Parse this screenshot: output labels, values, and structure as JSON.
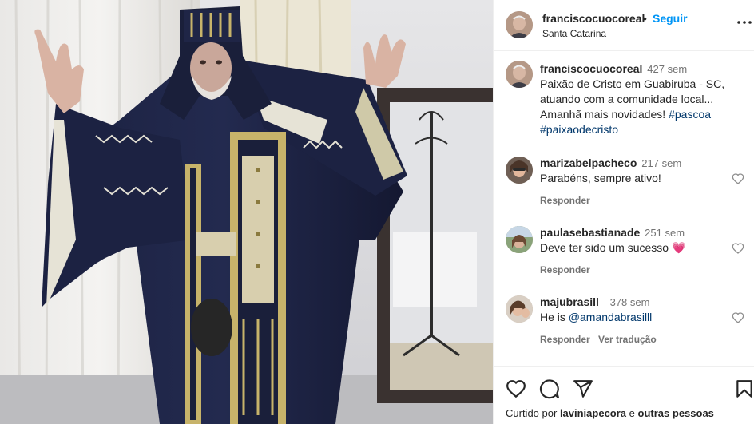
{
  "post": {
    "username": "franciscocuocoreal",
    "separator": "•",
    "follow_label": "Seguir",
    "location": "Santa Catarina"
  },
  "caption": {
    "username": "franciscocuocoreal",
    "time": "427 sem",
    "text": "Paixão de Cristo em Guabiruba - SC, atuando com a comunidade local... Amanhã mais novidades!",
    "hashtags": [
      "#pascoa",
      "#paixaodecristo"
    ]
  },
  "comments": [
    {
      "username": "marizabelpacheco",
      "time": "217 sem",
      "text": "Parabéns, sempre ativo!",
      "reply_label": "Responder"
    },
    {
      "username": "paulasebastianade",
      "time": "251 sem",
      "text": "Deve ter sido um sucesso",
      "emoji": "💗",
      "reply_label": "Responder"
    },
    {
      "username": "majubrasill_",
      "time": "378 sem",
      "text": "He is",
      "mention": "@amandabrasilll_",
      "reply_label": "Responder",
      "translate_label": "Ver tradução"
    }
  ],
  "likes": {
    "prefix": "Curtido por",
    "user": "laviniapecora",
    "middle": "e",
    "others": "outras pessoas"
  },
  "icons": {
    "more": "more-horizontal-icon",
    "like": "heart-icon",
    "comment": "comment-bubble-icon",
    "share": "send-icon",
    "save": "bookmark-icon"
  },
  "colors": {
    "accent": "#0095f6",
    "link": "#00376b",
    "muted": "#737373",
    "heart_emoji": "#e8457d"
  }
}
